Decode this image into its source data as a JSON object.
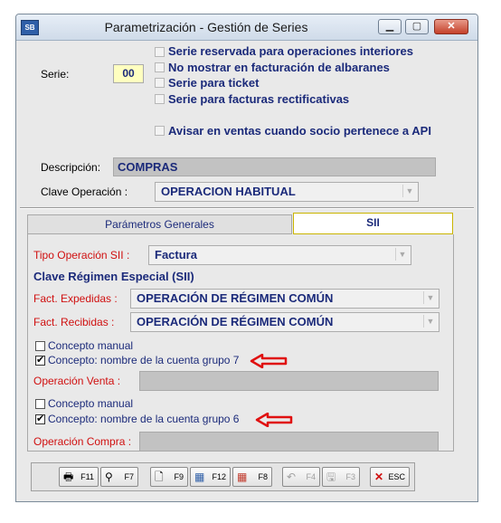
{
  "window": {
    "title": "Parametrización - Gestión de Series",
    "app_icon_text": "SB"
  },
  "serie": {
    "label": "Serie:",
    "value": "00",
    "options": [
      {
        "label": "Serie reservada para operaciones interiores",
        "checked": false
      },
      {
        "label": "No mostrar en facturación de albaranes",
        "checked": false
      },
      {
        "label": "Serie para ticket",
        "checked": false
      },
      {
        "label": "Serie para facturas rectificativas",
        "checked": false
      }
    ],
    "api_option": {
      "label": "Avisar en ventas cuando socio pertenece a API",
      "checked": false
    },
    "descripcion_label": "Descripción:",
    "descripcion_value": "COMPRAS",
    "clave_operacion_label": "Clave Operación :",
    "clave_operacion_value": "OPERACION HABITUAL"
  },
  "tabs": [
    {
      "label": "Parámetros Generales",
      "active": false
    },
    {
      "label": "SII",
      "active": true
    }
  ],
  "sii": {
    "tipo_operacion_label": "Tipo Operación SII :",
    "tipo_operacion_value": "Factura",
    "regimen_heading": "Clave Régimen Especial (SII)",
    "expedidas_label": "Fact. Expedidas :",
    "expedidas_value": "OPERACIÓN DE RÉGIMEN COMÚN",
    "recibidas_label": "Fact. Recibidas :",
    "recibidas_value": "OPERACIÓN DE RÉGIMEN COMÚN",
    "venta_concepto_manual": {
      "label": "Concepto manual",
      "checked": false
    },
    "venta_concepto_cuenta": {
      "label": "Concepto: nombre de la cuenta grupo 7",
      "checked": true
    },
    "operacion_venta_label": "Operación Venta :",
    "operacion_venta_value": "",
    "compra_concepto_manual": {
      "label": "Concepto manual",
      "checked": false
    },
    "compra_concepto_cuenta": {
      "label": "Concepto: nombre de la cuenta grupo 6",
      "checked": true
    },
    "operacion_compra_label": "Operación Compra :",
    "operacion_compra_value": ""
  },
  "toolbar": [
    {
      "key": "F11",
      "icon": "printer-icon",
      "enabled": true
    },
    {
      "key": "F7",
      "icon": "binoculars-icon",
      "enabled": true
    },
    {
      "key": "F9",
      "icon": "new-document-icon",
      "enabled": true
    },
    {
      "key": "F12",
      "icon": "edit-grid-icon",
      "enabled": true
    },
    {
      "key": "F8",
      "icon": "delete-grid-icon",
      "enabled": true
    },
    {
      "key": "F4",
      "icon": "undo-icon",
      "enabled": false
    },
    {
      "key": "F3",
      "icon": "save-icon",
      "enabled": false
    },
    {
      "key": "ESC",
      "icon": "close-x-icon",
      "enabled": true
    }
  ],
  "colors": {
    "annotation_arrow": "#e01010",
    "label_blue": "#1b2a7a",
    "label_red": "#d01010"
  }
}
